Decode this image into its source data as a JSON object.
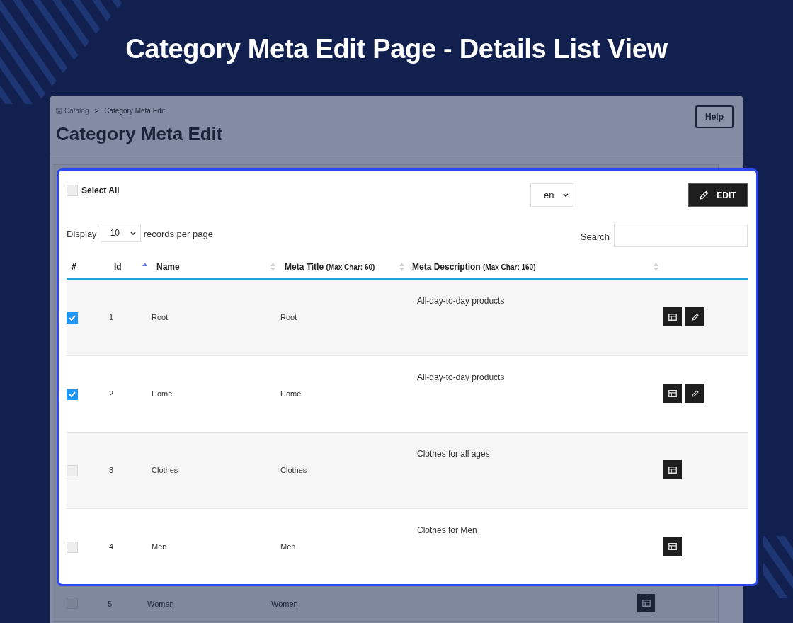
{
  "page_title": "Category Meta Edit Page - Details List View",
  "background_page": {
    "breadcrumb": [
      {
        "label": "Catalog"
      },
      {
        "label": "Category Meta Edit"
      }
    ],
    "breadcrumb_separator": ">",
    "title": "Category Meta Edit",
    "help_button": "Help",
    "rows": [
      {
        "selected": false,
        "id": "5",
        "name": "Women",
        "meta_title": "Women",
        "actions": [
          {
            "kind": "layout"
          }
        ]
      }
    ]
  },
  "panel": {
    "select_all": {
      "label": "Select All",
      "checked": false
    },
    "language_select": {
      "value": "en"
    },
    "edit_button": {
      "label": "EDIT"
    },
    "display": {
      "prefix": "Display",
      "value": "10",
      "suffix": "records per page"
    },
    "search": {
      "label": "Search"
    },
    "table": {
      "columns": [
        {
          "label": "#",
          "kind": "plain",
          "sorted": false
        },
        {
          "label": "Id",
          "kind": "sortable",
          "sorted": true
        },
        {
          "label": "Name",
          "kind": "sortable",
          "sorted": false
        },
        {
          "label": "Meta Title",
          "note": "(Max Char: 60)",
          "kind": "sortable",
          "sorted": false
        },
        {
          "label": "Meta Description",
          "note": "(Max Char: 160)",
          "kind": "sortable",
          "sorted": false
        }
      ],
      "rows": [
        {
          "selected": true,
          "id": "1",
          "name": "Root",
          "meta_title": "Root",
          "meta_description": "All-day-to-day products",
          "actions": [
            {
              "kind": "layout"
            },
            {
              "kind": "edit"
            }
          ]
        },
        {
          "selected": true,
          "id": "2",
          "name": "Home",
          "meta_title": "Home",
          "meta_description": "All-day-to-day products",
          "actions": [
            {
              "kind": "layout"
            },
            {
              "kind": "edit"
            }
          ]
        },
        {
          "selected": false,
          "id": "3",
          "name": "Clothes",
          "meta_title": "Clothes",
          "meta_description": "Clothes for all ages",
          "actions": [
            {
              "kind": "layout"
            }
          ]
        },
        {
          "selected": false,
          "id": "4",
          "name": "Men",
          "meta_title": "Men",
          "meta_description": "Clothes for Men",
          "actions": [
            {
              "kind": "layout"
            }
          ]
        }
      ]
    }
  }
}
